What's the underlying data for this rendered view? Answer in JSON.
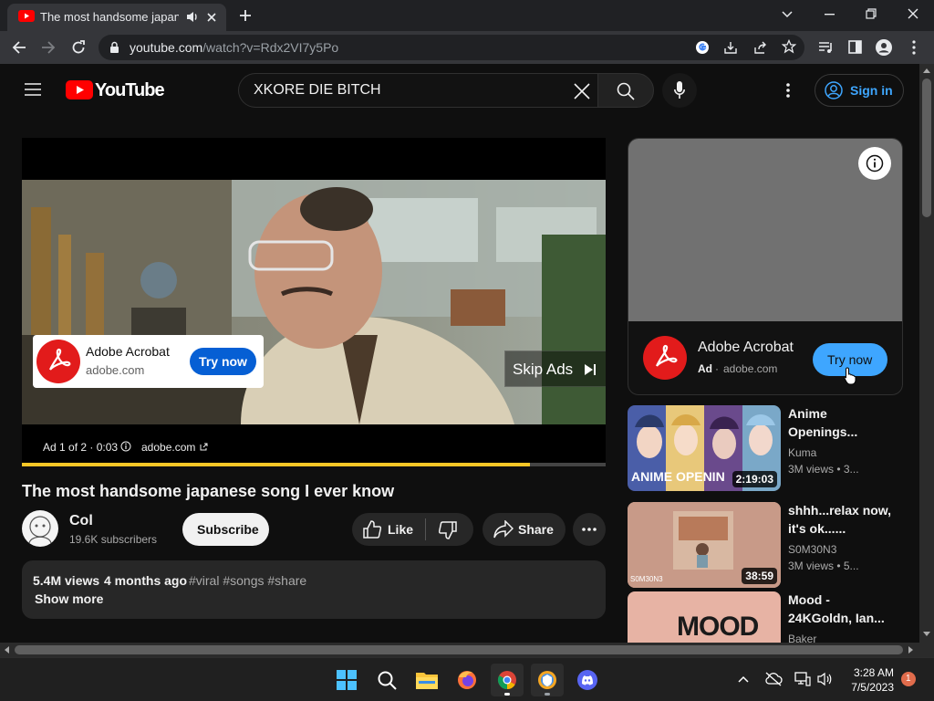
{
  "browser": {
    "tab_title": "The most handsome japanese song I ever know",
    "url_host": "youtube.com",
    "url_path": "/watch?v=Rdx2VI7y5Po"
  },
  "youtube": {
    "logo_text": "YouTube",
    "search_value": "XKORE DIE BITCH",
    "sign_in": "Sign in",
    "ad": {
      "advertiser": "Adobe Acrobat",
      "domain": "adobe.com",
      "cta": "Try now",
      "skip": "Skip Ads",
      "counter": "Ad 1 of 2 · 0:03",
      "link": "adobe.com",
      "progress": 0.87
    },
    "video": {
      "title": "The most handsome japanese song I ever know",
      "channel": "Col",
      "subscribers": "19.6K subscribers",
      "subscribe": "Subscribe",
      "like": "Like",
      "share": "Share",
      "views": "5.4M views",
      "age": "4 months ago",
      "hashtags": "#viral #songs #share",
      "show_more": "Show more"
    },
    "side_ad": {
      "advertiser": "Adobe Acrobat",
      "ad_label": "Ad",
      "domain": "adobe.com",
      "cta": "Try now"
    },
    "recommendations": [
      {
        "title": "Anime Openings...",
        "channel": "Kuma",
        "meta": "3M views • 3...",
        "duration": "2:19:03",
        "thumb_caption": "ANIME OPENIN"
      },
      {
        "title": "shhh...relax now, it's ok......",
        "channel": "S0M30N3",
        "meta": "3M views • 5...",
        "duration": "38:59",
        "thumb_caption": "S0M30N3"
      },
      {
        "title": "Mood - 24KGoldn, Ian...",
        "channel": "Baker",
        "meta": "",
        "duration": "",
        "thumb_caption": "MOOD"
      }
    ]
  },
  "taskbar": {
    "time": "3:28 AM",
    "date": "7/5/2023",
    "notifications": "1"
  }
}
